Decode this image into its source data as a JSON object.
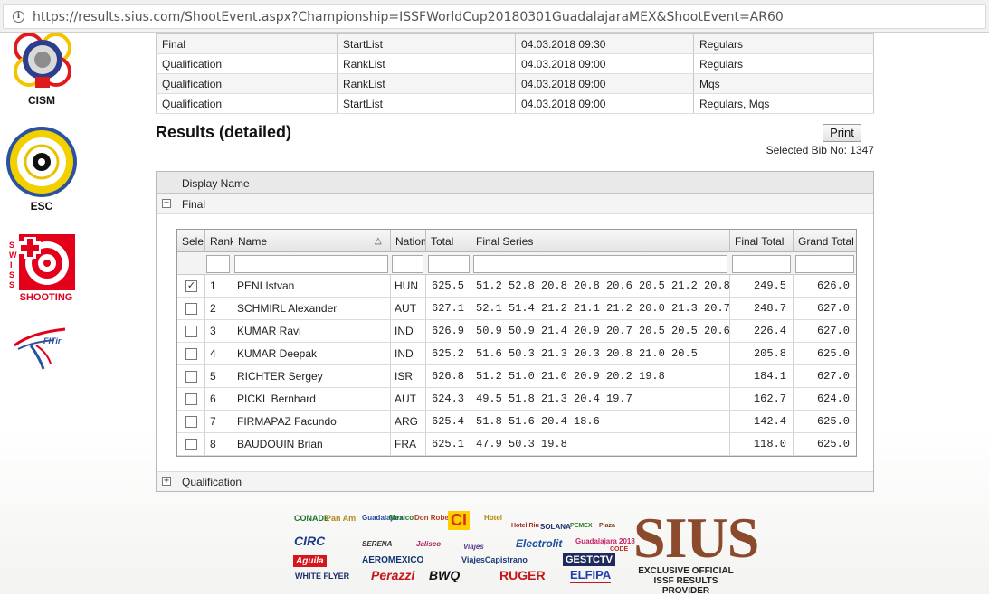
{
  "browser": {
    "url": "https://results.sius.com/ShootEvent.aspx?Championship=ISSFWorldCup20180301GuadalajaraMEX&ShootEvent=AR60"
  },
  "sidebar_logos": [
    {
      "label": "CISM",
      "icon": "cism-logo"
    },
    {
      "label": "ESC",
      "icon": "esc-logo"
    },
    {
      "label": "SHOOTING",
      "side_text": "SWISS",
      "icon": "swiss-shooting-logo"
    },
    {
      "label": "FITir",
      "icon": "fitir-logo"
    }
  ],
  "upper_table": {
    "rows": [
      {
        "phase": "Final",
        "type": "StartList",
        "datetime": "04.03.2018 09:30",
        "groups": "Regulars"
      },
      {
        "phase": "Qualification",
        "type": "RankList",
        "datetime": "04.03.2018 09:00",
        "groups": "Regulars"
      },
      {
        "phase": "Qualification",
        "type": "RankList",
        "datetime": "04.03.2018 09:00",
        "groups": "Mqs"
      },
      {
        "phase": "Qualification",
        "type": "StartList",
        "datetime": "04.03.2018 09:00",
        "groups": "Regulars, Mqs"
      }
    ]
  },
  "results": {
    "title": "Results (detailed)",
    "print_label": "Print",
    "selected_bib": "Selected Bib No: 1347",
    "outer_header": "Display Name",
    "group_final": "Final",
    "group_qualification": "Qualification",
    "columns": {
      "select": "Select",
      "rank": "Rank",
      "name": "Name",
      "nation": "Nation",
      "total": "Total",
      "final_series": "Final Series",
      "final_total": "Final Total",
      "grand_total": "Grand Total"
    },
    "rows": [
      {
        "checked": "✓",
        "rank": "1",
        "name": "PENI Istvan",
        "nation": "HUN",
        "total": "625.5",
        "series": "51.2 52.8 20.8 20.8 20.6 20.5 21.2 20.8",
        "final_total": "249.5",
        "grand_total": "626.0"
      },
      {
        "checked": "",
        "rank": "2",
        "name": "SCHMIRL Alexander",
        "nation": "AUT",
        "total": "627.1",
        "series": "52.1 51.4 21.2 21.1 21.2 20.0 21.3 20.7",
        "final_total": "248.7",
        "grand_total": "627.0"
      },
      {
        "checked": "",
        "rank": "3",
        "name": "KUMAR Ravi",
        "nation": "IND",
        "total": "626.9",
        "series": "50.9 50.9 21.4 20.9 20.7 20.5 20.5 20.6",
        "final_total": "226.4",
        "grand_total": "627.0"
      },
      {
        "checked": "",
        "rank": "4",
        "name": "KUMAR Deepak",
        "nation": "IND",
        "total": "625.2",
        "series": "51.6 50.3 21.3 20.3 20.8 21.0 20.5",
        "final_total": "205.8",
        "grand_total": "625.0"
      },
      {
        "checked": "",
        "rank": "5",
        "name": "RICHTER Sergey",
        "nation": "ISR",
        "total": "626.8",
        "series": "51.2 51.0 21.0 20.9 20.2 19.8",
        "final_total": "184.1",
        "grand_total": "627.0"
      },
      {
        "checked": "",
        "rank": "6",
        "name": "PICKL Bernhard",
        "nation": "AUT",
        "total": "624.3",
        "series": "49.5 51.8 21.3 20.4 19.7",
        "final_total": "162.7",
        "grand_total": "624.0"
      },
      {
        "checked": "",
        "rank": "7",
        "name": "FIRMAPAZ Facundo",
        "nation": "ARG",
        "total": "625.4",
        "series": "51.8 51.6 20.4 18.6",
        "final_total": "142.4",
        "grand_total": "625.0"
      },
      {
        "checked": "",
        "rank": "8",
        "name": "BAUDOUIN Brian",
        "nation": "FRA",
        "total": "625.1",
        "series": "47.9 50.3 19.8",
        "final_total": "118.0",
        "grand_total": "625.0"
      }
    ]
  },
  "sponsors": {
    "logos": [
      "CONADE",
      "Pan Am",
      "Guadalajara",
      "Mexico",
      "Don Roberto",
      "CI",
      "Hotel",
      "SOLANA",
      "PEMEX",
      "Plaza",
      "Hotel Riu",
      "CIRC",
      "SERENA",
      "Jalisco",
      "Viajes",
      "Electrolit",
      "Guadalajara 2018",
      "CODE",
      "Aguila",
      "AEROMEXICO",
      "ViajesCapistrano",
      "GESTCTV",
      "WHITE FLYER",
      "Perazzi",
      "BWQ",
      "RUGER",
      "ELFIPA"
    ],
    "sius": "SIUS",
    "sius_line1": "EXCLUSIVE OFFICIAL",
    "sius_line2": "ISSF RESULTS PROVIDER"
  }
}
